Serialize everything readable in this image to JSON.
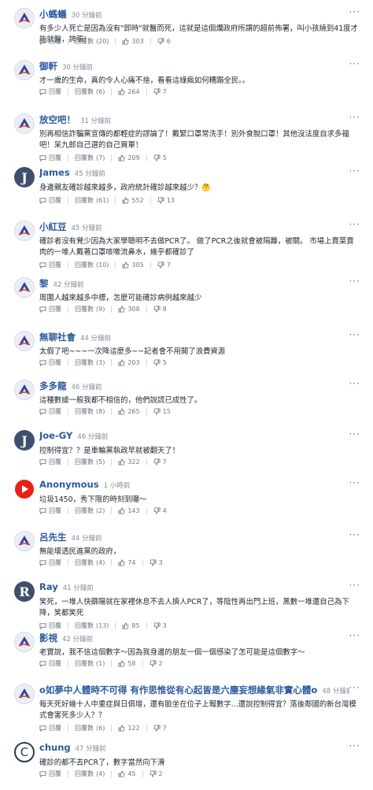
{
  "ui": {
    "reply_label": "回覆",
    "replies_prefix": "回覆數",
    "more_glyph": "···"
  },
  "comments": [
    {
      "name": "小螞蟻",
      "time": "30 分鐘前",
      "avatar_type": "logo",
      "avatar_letter": "",
      "text": "有多少人死亡是因為沒有\"即時\"就醫而死，這就是這個爛政府所謂的超前佈署，叫小孩燒到41度才能就醫，誇張!",
      "replies": "(20)",
      "likes": "303",
      "dislikes": "6"
    },
    {
      "name": "御軒",
      "time": "30 分鐘前",
      "avatar_type": "logo",
      "avatar_letter": "",
      "text": "才一歲的生命，真的令人心痛不捨，看看這綠瘋如何糟蹋全民。。",
      "replies": "(6)",
      "likes": "264",
      "dislikes": "7"
    },
    {
      "name": "放空吧！",
      "time": "31 分鐘前",
      "avatar_type": "logo",
      "avatar_letter": "",
      "text": "別再相信詐騙黨宣傳的都輕症的謬論了！戴緊口罩常洗手！別外食脫口罩！其他沒法度自求多福吧！呆九郎自己選的自己買單！",
      "replies": "(7)",
      "likes": "209",
      "dislikes": "5"
    },
    {
      "name": "James",
      "time": "45 分鐘前",
      "avatar_type": "letter",
      "avatar_letter": "J",
      "text": "身邊親友確診越來越多，政府統計確診越來越少？🤔",
      "replies": "(61)",
      "likes": "552",
      "dislikes": "13"
    },
    {
      "name": "小紅豆",
      "time": "45 分鐘前",
      "avatar_type": "logo",
      "avatar_letter": "",
      "text": "確診者沒有覺少因為大家學聰明不去做PCR了。 做了PCR之後就會被隔離，被關。 市場上賣菜賣肉的一堆人戴著口罩咳嗽流鼻水，幾乎都確診了",
      "replies": "(10)",
      "likes": "305",
      "dislikes": "7"
    },
    {
      "name": "黎",
      "time": "42 分鐘前",
      "avatar_type": "logo",
      "avatar_letter": "",
      "text": "周圍人越來越多中標，怎麼可能確診病例越來越少",
      "replies": "(9)",
      "likes": "308",
      "dislikes": "8"
    },
    {
      "name": "無聊社會",
      "time": "44 分鐘前",
      "avatar_type": "logo",
      "avatar_letter": "",
      "text": "太假了吧~~~一次降這麼多~~記者會不用開了浪費資源",
      "replies": "(3)",
      "likes": "203",
      "dislikes": "5"
    },
    {
      "name": "多多龍",
      "time": "46 分鐘前",
      "avatar_type": "logo",
      "avatar_letter": "",
      "text": "這種數據一般我都不相信的，他們說謊已成性了。",
      "replies": "(8)",
      "likes": "265",
      "dislikes": "15"
    },
    {
      "name": "Joe-GY",
      "time": "46 分鐘前",
      "avatar_type": "letter",
      "avatar_letter": "J",
      "text": "控制得宜？？是車輪黨執政早就被翻天了！",
      "replies": "(5)",
      "likes": "322",
      "dislikes": "7"
    },
    {
      "name": "Anonymous",
      "time": "1 小時前",
      "avatar_type": "yt",
      "avatar_letter": "",
      "text": "垃圾1450，秀下限的時刻到囉～",
      "replies": "(2)",
      "likes": "143",
      "dislikes": "4"
    },
    {
      "name": "呂先生",
      "time": "44 分鐘前",
      "avatar_type": "logo",
      "avatar_letter": "",
      "text": "無能壞透民進黨的政府，",
      "replies": "(4)",
      "likes": "74",
      "dislikes": "3"
    },
    {
      "name": "Ray",
      "time": "41 分鐘前",
      "avatar_type": "letter",
      "avatar_letter": "R",
      "text": "笑死，一堆人快篩陽就在家裡休息不去人擠人PCR了，等陰性再出門上班，黑數一堆還自己為下降，笑都笑死",
      "replies": "(13)",
      "likes": "85",
      "dislikes": "3"
    },
    {
      "name": "影視",
      "time": "42 分鐘前",
      "avatar_type": "logo",
      "avatar_letter": "",
      "text": "老實說，我不信這個數字～因為我身邊的朋友一個一個感染了怎可能是這個數字～",
      "replies": "(1)",
      "likes": "58",
      "dislikes": "2"
    },
    {
      "name": "o如夢中人體時不可得 有作思惟從有心起皆是六塵妄想緣氣非實心體o",
      "time": "48 分鐘前",
      "avatar_type": "logo",
      "avatar_letter": "",
      "text": "每天死好幾十人中重症與日俱增，還有臉坐在位子上報數字...還說控制得宜？落後鄰國的新台灣模式會害死多少人？？",
      "replies": "(6)",
      "likes": "122",
      "dislikes": "7"
    },
    {
      "name": "chung",
      "time": "47 分鐘前",
      "avatar_type": "ring",
      "avatar_letter": "C",
      "text": "確診的都不去PCR了，數字當然向下滑",
      "replies": "(4)",
      "likes": "45",
      "dislikes": "2"
    }
  ]
}
